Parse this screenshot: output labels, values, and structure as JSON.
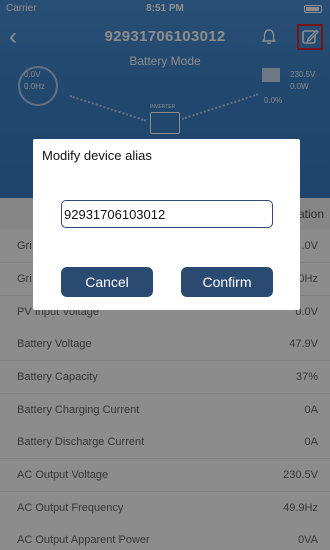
{
  "status_bar": {
    "carrier": "Carrier",
    "time": "8:51 PM"
  },
  "header": {
    "title": "92931706103012",
    "subtitle": "Battery Mode",
    "back_icon": "chevron-left-icon",
    "bell_icon": "bell-icon",
    "edit_icon": "edit-icon",
    "background_color": "#3f82c8",
    "highlight_color": "#d9262c",
    "diagram": {
      "grid_values": [
        "0.0V",
        "0.0Hz"
      ],
      "output_values": [
        "230.5V",
        "0.0W"
      ],
      "load_percent": "0.0%",
      "inverter_label": "INVERTER"
    }
  },
  "table": {
    "header_partial": "ation",
    "rows": [
      {
        "label": "Gri",
        "value": ".0V"
      },
      {
        "label": "Gri",
        "value": ".0Hz"
      },
      {
        "label": "PV Input Voltage",
        "value": "0.0V"
      },
      {
        "label": "Battery Voltage",
        "value": "47.9V"
      },
      {
        "label": "Battery Capacity",
        "value": "37%"
      },
      {
        "label": "Battery Charging Current",
        "value": "0A"
      },
      {
        "label": "Battery Discharge Current",
        "value": "0A"
      },
      {
        "label": "AC Output Voltage",
        "value": "230.5V"
      },
      {
        "label": "AC Output Frequency",
        "value": "49.9Hz"
      },
      {
        "label": "AC Output Apparent Power",
        "value": "0VA"
      }
    ]
  },
  "dialog": {
    "title": "Modify device alias",
    "input_value": "92931706103012",
    "cancel_label": "Cancel",
    "confirm_label": "Confirm",
    "button_color": "#2b4a72"
  }
}
